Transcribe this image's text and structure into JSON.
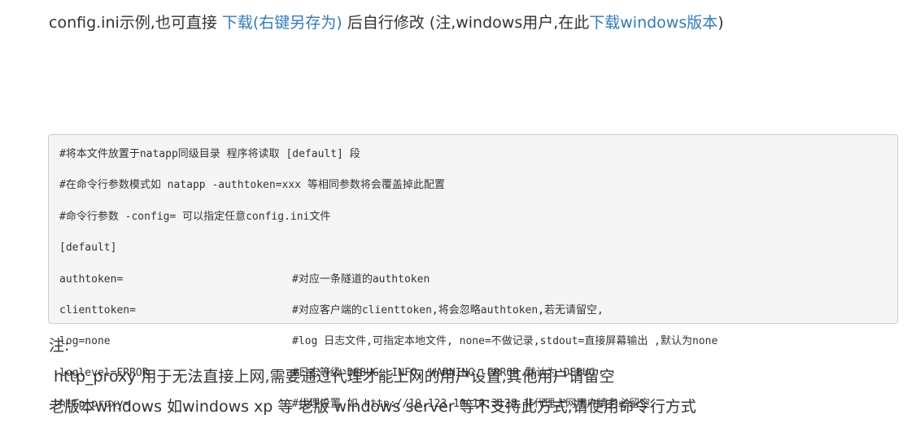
{
  "intro": {
    "prefix": "config.ini示例,也可直接 ",
    "download_link": "下载(右键另存为)",
    "middle": " 后自行修改 (注,windows用户,在此",
    "windows_link": "下载windows版本",
    "suffix": ")"
  },
  "code": {
    "lines": [
      "#将本文件放置于natapp同级目录 程序将读取 [default] 段",
      "#在命令行参数模式如 natapp -authtoken=xxx 等相同参数将会覆盖掉此配置",
      "#命令行参数 -config= 可以指定任意config.ini文件",
      "[default]"
    ],
    "config_rows": [
      {
        "key": "authtoken=",
        "comment": "#对应一条隧道的authtoken"
      },
      {
        "key": "clienttoken=",
        "comment": "#对应客户端的clienttoken,将会忽略authtoken,若无请留空,"
      },
      {
        "key": "log=none",
        "comment": "#log 日志文件,可指定本地文件, none=不做记录,stdout=直接屏幕输出 ,默认为none"
      },
      {
        "key": "loglevel=ERROR",
        "comment": "#日志等级 DEBUG, INFO, WARNING, ERROR 默认为 DEBUG"
      },
      {
        "key": "http_proxy=",
        "comment": "#代理设置 如 http://10.123.10.10:3128 非代理上网用户请务必留空"
      }
    ]
  },
  "notes": {
    "title": "注:",
    "line1": "http_proxy 用于无法直接上网,需要通过代理才能上网的用户设置,其他用户请留空",
    "line2": "老版本windows 如windows xp 等 老版 windows server 等不支持此方式,请使用命令行方式"
  },
  "colors": {
    "link": "#337ab7",
    "text": "#333333",
    "code_bg": "#f5f5f5",
    "code_border": "#cccccc"
  }
}
